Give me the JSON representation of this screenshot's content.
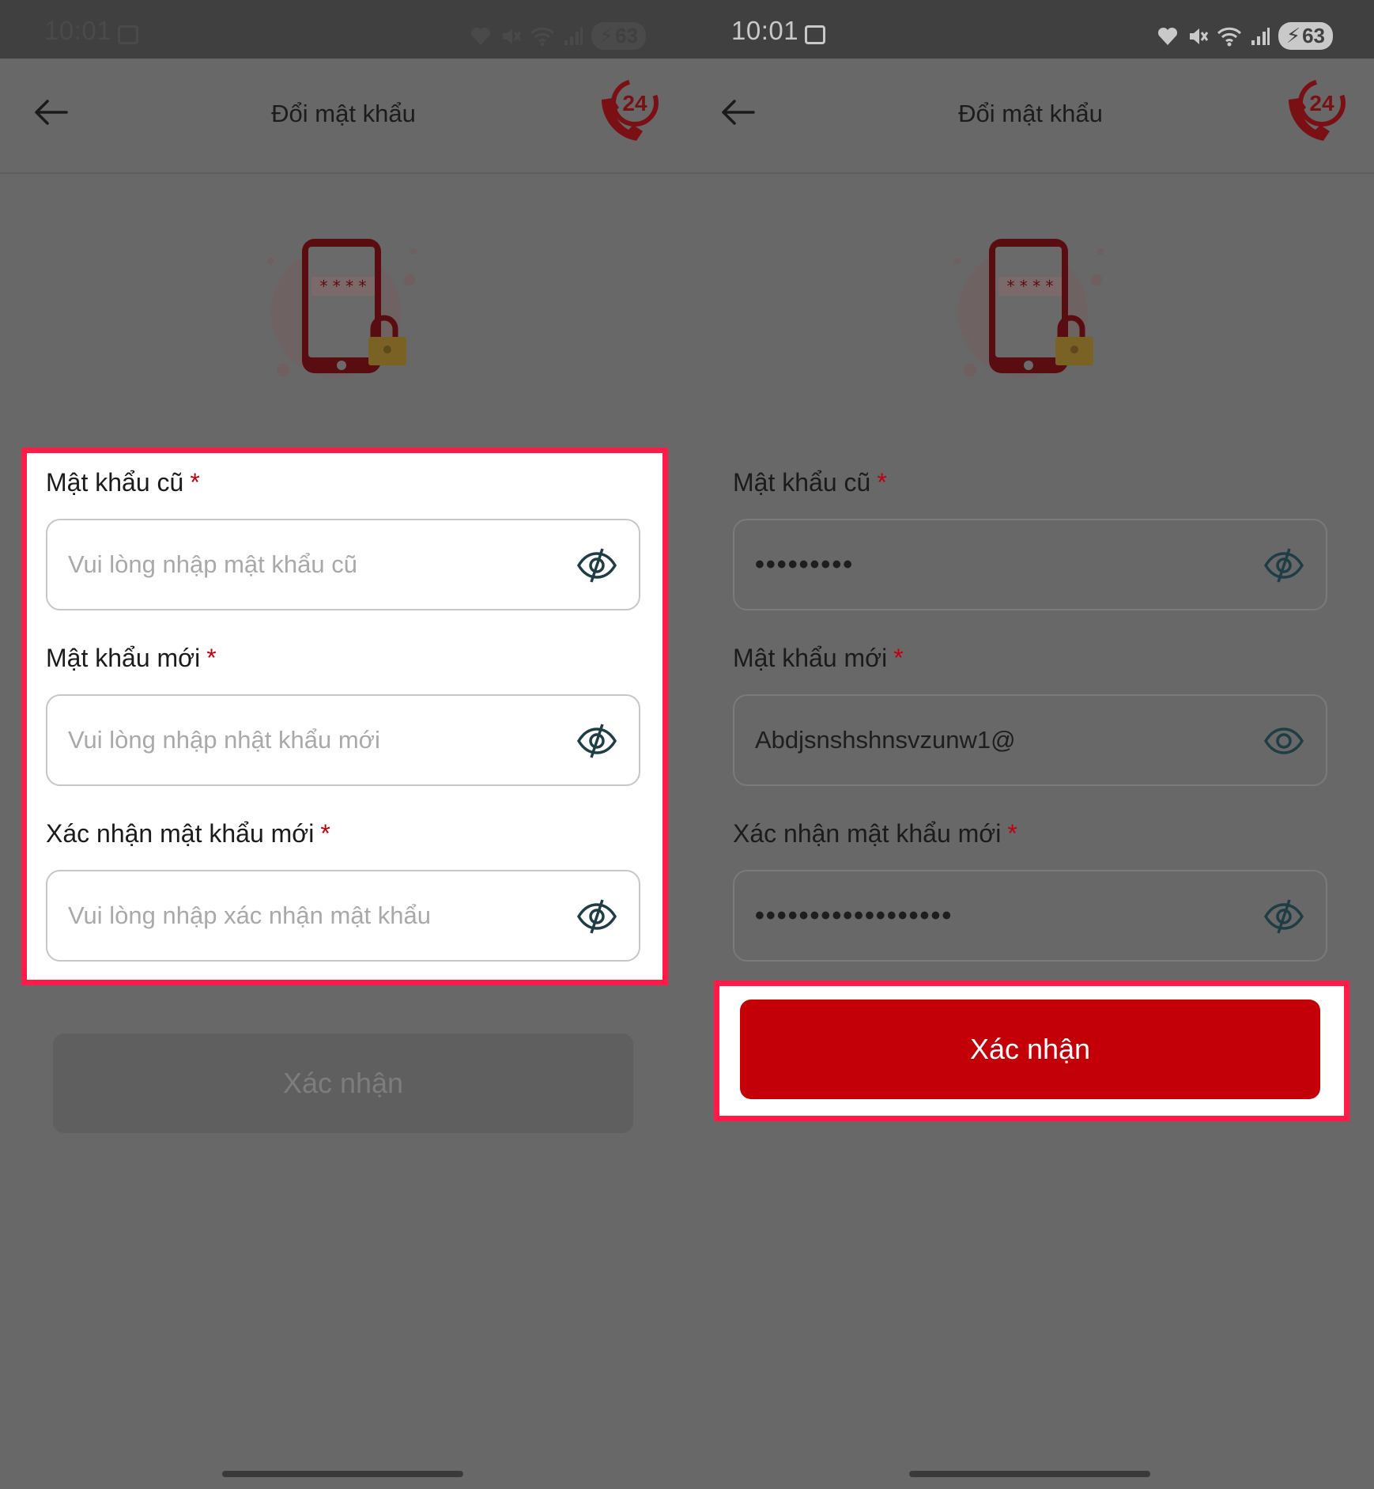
{
  "status_bar": {
    "time": "10:01",
    "battery": "63"
  },
  "header": {
    "title": "Đổi mật khẩu",
    "support_badge": "24"
  },
  "form": {
    "old_password": {
      "label": "Mật khẩu cũ",
      "placeholder": "Vui lòng nhập mật khẩu cũ",
      "value_masked": "•••••••••"
    },
    "new_password": {
      "label": "Mật khẩu mới",
      "placeholder": "Vui lòng nhập nhật khẩu mới",
      "value": "Abdjsnshshnsvzunw1@"
    },
    "confirm_password": {
      "label": "Xác nhận mật khẩu mới",
      "placeholder": "Vui lòng nhập xác nhận mật khẩu",
      "value_masked": "••••••••••••••••••"
    },
    "required_mark": "*"
  },
  "submit": {
    "label": "Xác nhận"
  },
  "colors": {
    "accent": "#c30007",
    "highlight": "#ff1a47",
    "overlay": "#686868"
  },
  "icons": {
    "back": "arrow-left-icon",
    "support": "phone-24-icon",
    "eye_hidden": "eye-off-icon",
    "eye_visible": "eye-icon"
  }
}
